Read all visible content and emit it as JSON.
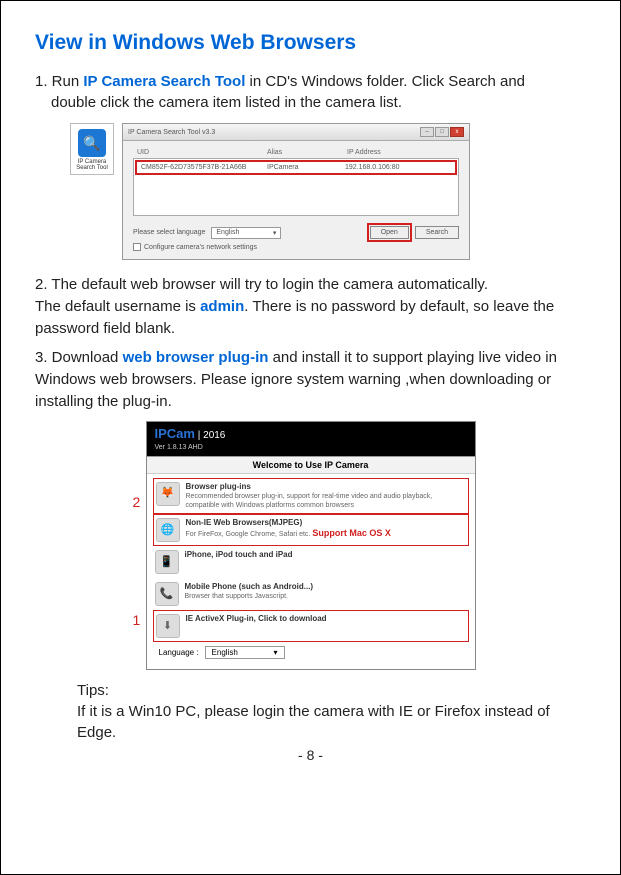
{
  "title": "View in Windows Web Browsers",
  "step1": {
    "prefix": "1. Run ",
    "tool": "IP Camera Search Tool",
    "rest1": " in CD's Windows folder. Click Search and",
    "rest2": "double click the camera item listed in the camera list."
  },
  "appIcon": {
    "label": "IP Camera Search Tool",
    "glyph": "🔍"
  },
  "toolWindow": {
    "title": "IP Camera Search Tool  v3.3",
    "cols": {
      "uid": "UID",
      "alias": "Alias",
      "ip": "IP Address"
    },
    "row": {
      "uid": "CM852F-62D73575F37B-21A66B",
      "alias": "IPCamera",
      "ip": "192.168.0.106:80"
    },
    "langLabel": "Please select language",
    "langValue": "English",
    "openBtn": "Open",
    "searchBtn": "Search",
    "cfgLabel": "Configure camera's network settings"
  },
  "step2": {
    "line1": "2. The default web browser will try to login the camera automatically.",
    "line2a": "The default username is ",
    "admin": "admin",
    "line2b": ". There is no password by default, so leave the password field blank."
  },
  "step3": {
    "prefix": "3. Download ",
    "plugin": "web browser plug-in",
    "rest": " and install it to support playing live video in Windows web browsers. Please ignore system warning ,when downloading or installing the plug-in."
  },
  "ipcam": {
    "brand": "IPCam",
    "year": "|  2016",
    "ver": "Ver   1.8.13 AHD",
    "welcome": "Welcome to Use IP Camera",
    "opts": [
      {
        "icon": "🦊",
        "title": "Browser plug-ins",
        "desc": "Recommended browser plug-in, support for real-time video and audio playback, compatible with Windows platforms common browsers"
      },
      {
        "icon": "🌐",
        "title": "Non-IE Web Browsers(MJPEG)",
        "desc": "For FireFox, Google Chrome, Safari etc."
      },
      {
        "icon": "📱",
        "title": "iPhone, iPod touch and iPad",
        "desc": ""
      },
      {
        "icon": "📞",
        "title": "Mobile Phone (such as Android...)",
        "desc": "Browser that supports Javascript."
      },
      {
        "icon": "⬇",
        "title": "IE ActiveX Plug-in, Click to download",
        "desc": ""
      }
    ],
    "macLabel": "Support Mac OS X",
    "langLabel": "Language :",
    "langValue": "English",
    "callout1": "1",
    "callout2": "2"
  },
  "tips": {
    "heading": "Tips:",
    "body": "If it is a Win10 PC, please login the camera with IE or Firefox instead of Edge."
  },
  "pageNum": "-  8  -"
}
